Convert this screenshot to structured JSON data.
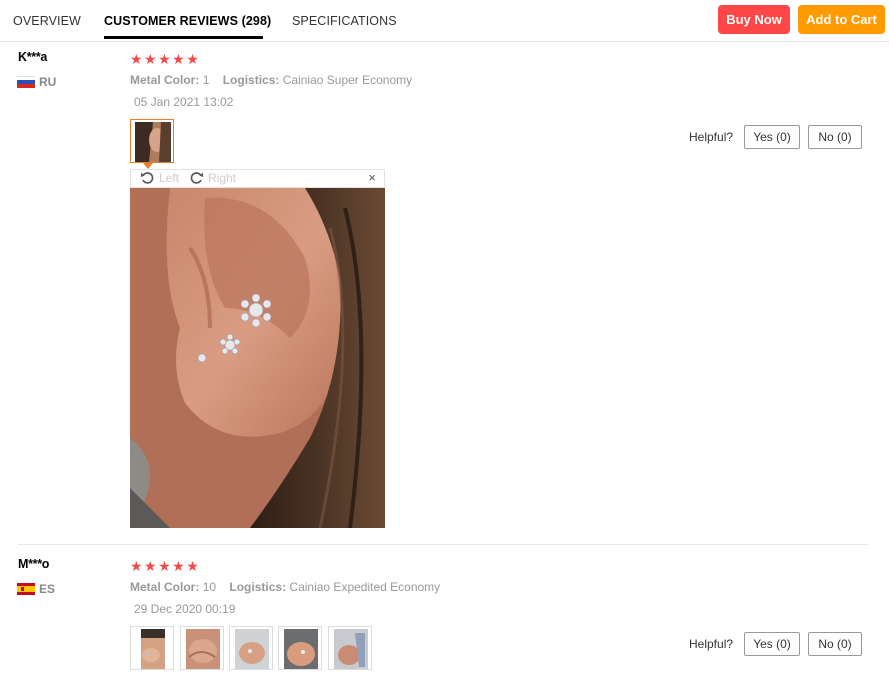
{
  "tabs": {
    "overview": "OVERVIEW",
    "reviews": "CUSTOMER REVIEWS (298)",
    "specs": "SPECIFICATIONS"
  },
  "actions": {
    "buy_now": "Buy Now",
    "add_to_cart": "Add to Cart",
    "buy_color": "#ff4747",
    "cart_color": "#ff9a00"
  },
  "reviews": [
    {
      "user": "K***a",
      "country": "RU",
      "flag_icon": "russia-flag-icon",
      "stars": "★★★★★",
      "rating": 5,
      "metal_label": "Metal Color:",
      "metal_value": "1",
      "logistics_label": "Logistics:",
      "logistics_value": "Cainiao Super Economy",
      "date": "05 Jan 2021 13:02",
      "helpful": "Helpful?",
      "yes": "Yes (0)",
      "no": "No (0)",
      "viewer": {
        "left": "Left",
        "right": "Right",
        "close": "×"
      }
    },
    {
      "user": "M***o",
      "country": "ES",
      "flag_icon": "spain-flag-icon",
      "stars": "★★★★★",
      "rating": 5,
      "metal_label": "Metal Color:",
      "metal_value": "10",
      "logistics_label": "Logistics:",
      "logistics_value": "Cainiao Expedited Economy",
      "date": "29 Dec 2020 00:19",
      "helpful": "Helpful?",
      "yes": "Yes (0)",
      "no": "No (0)"
    }
  ],
  "star_color": "#f04a4a",
  "accent": "#e87d2b"
}
